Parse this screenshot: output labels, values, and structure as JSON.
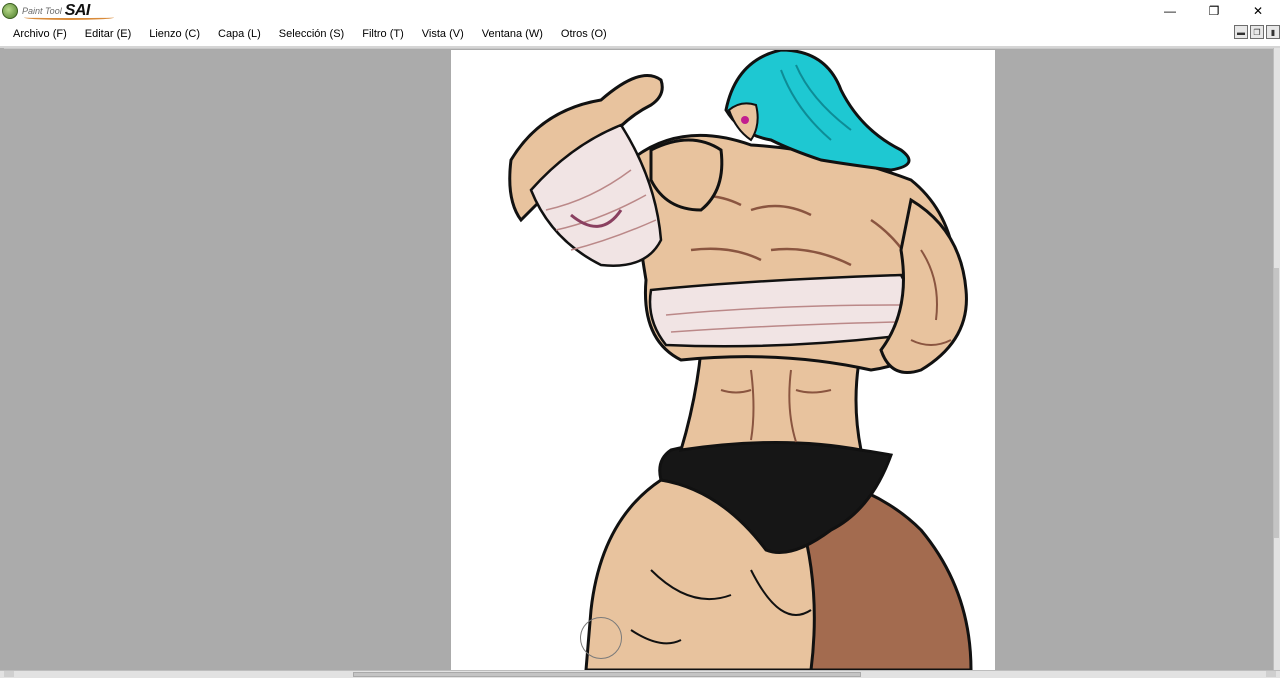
{
  "app": {
    "logo_small": "Paint Tool",
    "logo_big": "SAI"
  },
  "window_controls": {
    "minimize": "—",
    "restore": "❐",
    "close": "✕"
  },
  "menu": [
    {
      "label": "Archivo (F)"
    },
    {
      "label": "Editar (E)"
    },
    {
      "label": "Lienzo (C)"
    },
    {
      "label": "Capa (L)"
    },
    {
      "label": "Selección (S)"
    },
    {
      "label": "Filtro (T)"
    },
    {
      "label": "Vista (V)"
    },
    {
      "label": "Ventana (W)"
    },
    {
      "label": "Otros (O)"
    }
  ],
  "canvas": {
    "hair_color": "#1ec8d2",
    "skin_color": "#e8c39e",
    "skin_shadow": "#a36b4f",
    "wrap_color": "#f1e4e4",
    "shorts_color": "#161616",
    "background": "#ababab"
  }
}
